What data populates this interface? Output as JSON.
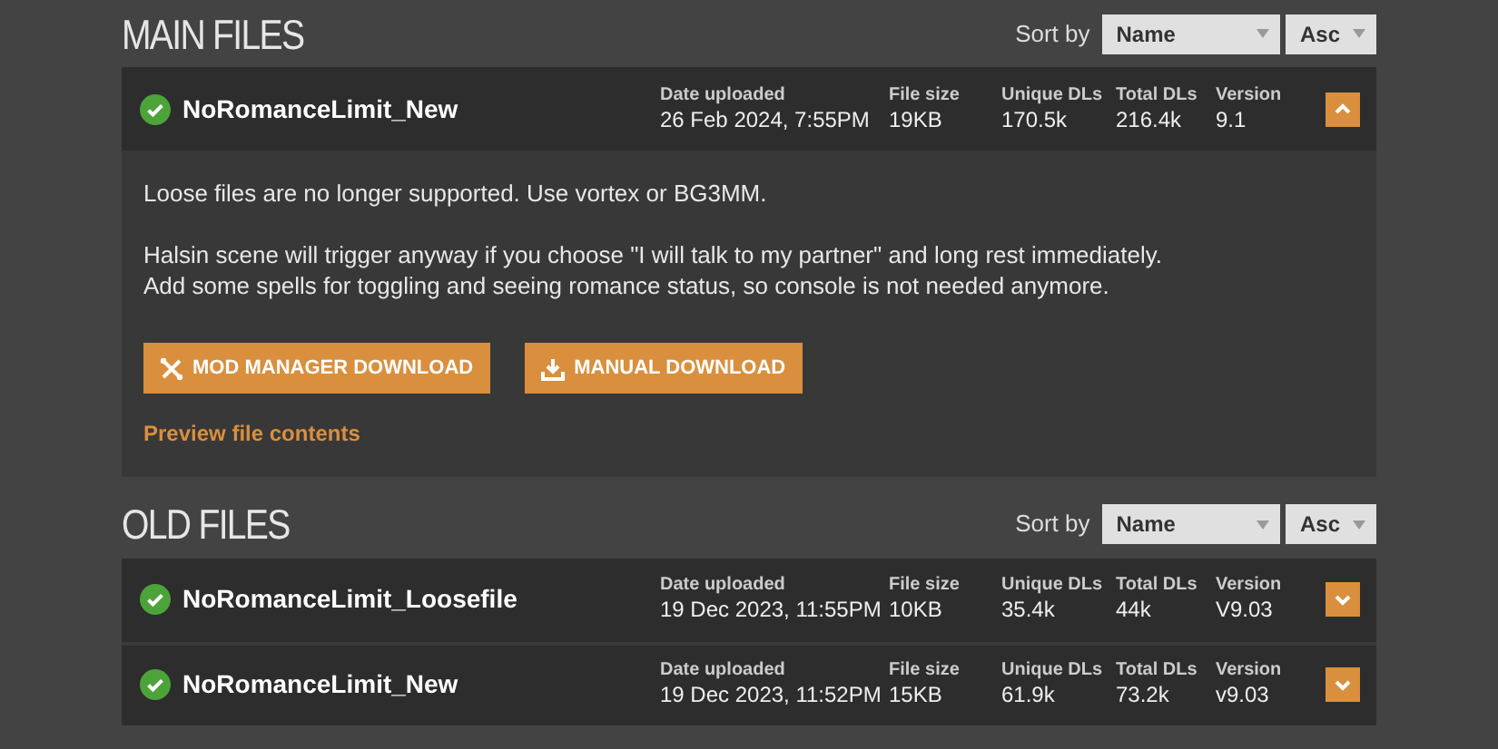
{
  "sections": [
    {
      "title": "MAIN FILES",
      "sort_label": "Sort by",
      "sort_field": "Name",
      "sort_order": "Asc",
      "files": [
        {
          "name": "NoRomanceLimit_New",
          "verified": true,
          "expanded": true,
          "meta": [
            {
              "label": "Date uploaded",
              "value": "26 Feb 2024, 7:55PM"
            },
            {
              "label": "File size",
              "value": "19KB"
            },
            {
              "label": "Unique DLs",
              "value": "170.5k"
            },
            {
              "label": "Total DLs",
              "value": "216.4k"
            },
            {
              "label": "Version",
              "value": "9.1"
            }
          ],
          "description": [
            [
              "Loose files are no longer supported. Use vortex or BG3MM."
            ],
            [
              "Halsin scene will trigger anyway if you choose \"I will talk to my partner\" and long rest immediately.",
              "Add some spells for toggling and seeing romance status, so console is not needed anymore."
            ]
          ],
          "buttons": [
            {
              "kind": "manager",
              "label": "MOD MANAGER DOWNLOAD"
            },
            {
              "kind": "manual",
              "label": "MANUAL DOWNLOAD"
            }
          ],
          "preview_link": "Preview file contents"
        }
      ]
    },
    {
      "title": "OLD FILES",
      "sort_label": "Sort by",
      "sort_field": "Name",
      "sort_order": "Asc",
      "files": [
        {
          "name": "NoRomanceLimit_Loosefile",
          "verified": true,
          "expanded": false,
          "meta": [
            {
              "label": "Date uploaded",
              "value": "19 Dec 2023, 11:55PM"
            },
            {
              "label": "File size",
              "value": "10KB"
            },
            {
              "label": "Unique DLs",
              "value": "35.4k"
            },
            {
              "label": "Total DLs",
              "value": "44k"
            },
            {
              "label": "Version",
              "value": "V9.03"
            }
          ]
        },
        {
          "name": "NoRomanceLimit_New",
          "verified": true,
          "expanded": false,
          "meta": [
            {
              "label": "Date uploaded",
              "value": "19 Dec 2023, 11:52PM"
            },
            {
              "label": "File size",
              "value": "15KB"
            },
            {
              "label": "Unique DLs",
              "value": "61.9k"
            },
            {
              "label": "Total DLs",
              "value": "73.2k"
            },
            {
              "label": "Version",
              "value": "v9.03"
            }
          ]
        }
      ]
    }
  ]
}
